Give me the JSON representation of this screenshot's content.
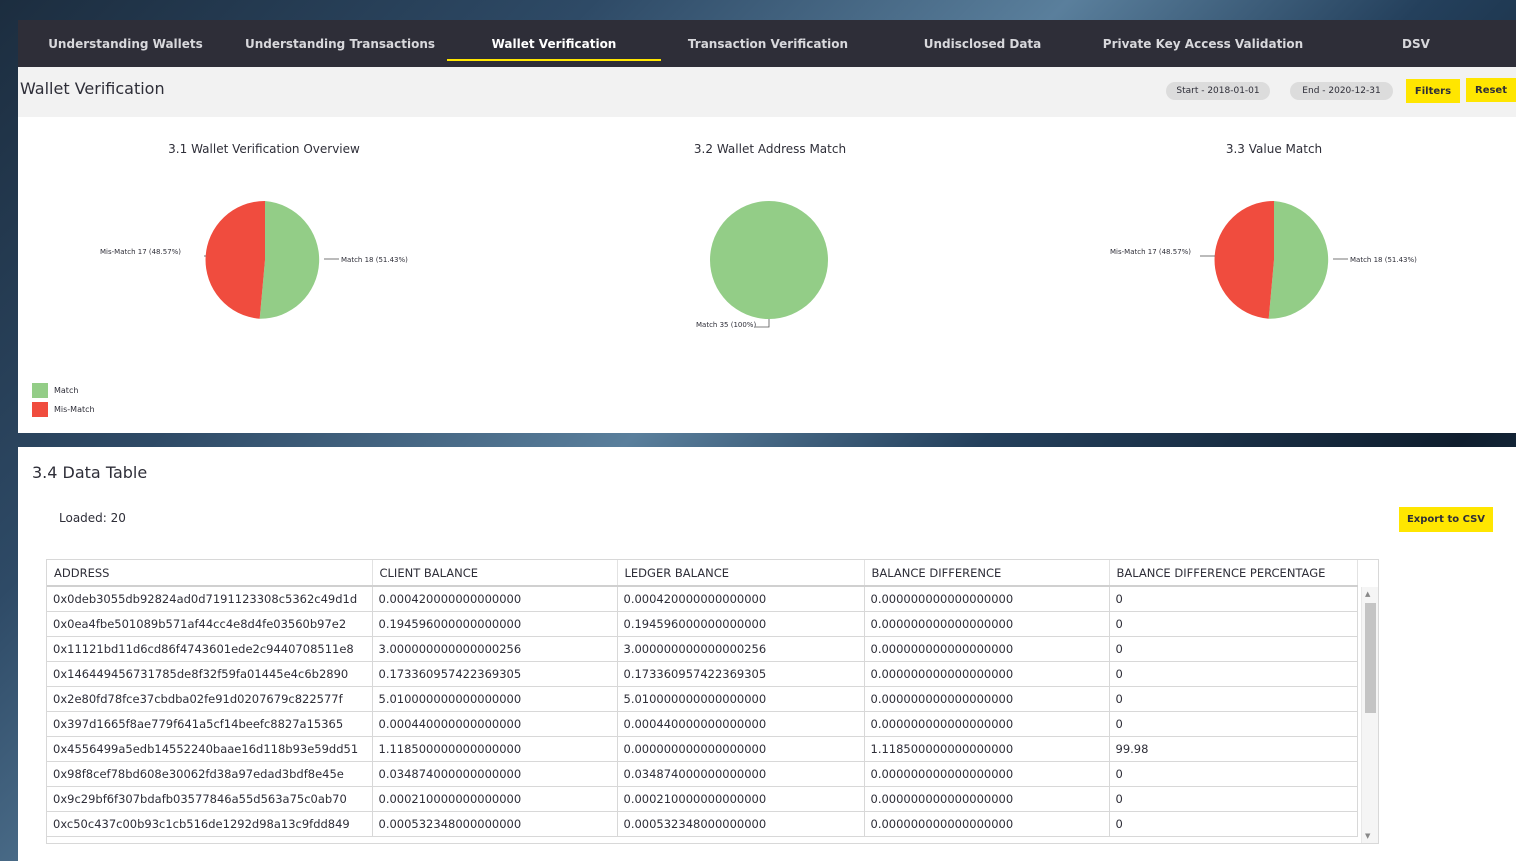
{
  "nav": {
    "tabs": [
      {
        "label": "Understanding Wallets",
        "active": false
      },
      {
        "label": "Understanding Transactions",
        "active": false
      },
      {
        "label": "Wallet Verification",
        "active": true
      },
      {
        "label": "Transaction Verification",
        "active": false
      },
      {
        "label": "Undisclosed Data",
        "active": false
      },
      {
        "label": "Private Key Access Validation",
        "active": false
      },
      {
        "label": "DSV",
        "active": false
      }
    ]
  },
  "header": {
    "title": "Wallet Verification",
    "start": "Start - 2018-01-01",
    "end": "End - 2020-12-31",
    "filters_label": "Filters",
    "reset_label": "Reset"
  },
  "colors": {
    "match": "#93cd87",
    "mismatch": "#f04c3e",
    "accent": "#ffe600",
    "nav_bg": "#2e2e38"
  },
  "charts": {
    "overview": {
      "title": "3.1 Wallet Verification Overview",
      "mismatch_label": "Mis-Match 17 (48.57%)",
      "match_label": "Match 18 (51.43%)"
    },
    "address": {
      "title": "3.2 Wallet Address Match",
      "match_label": "Match 35 (100%)"
    },
    "value": {
      "title": "3.3 Value Match",
      "mismatch_label": "Mis-Match 17 (48.57%)",
      "match_label": "Match 18 (51.43%)"
    },
    "legend": {
      "match": "Match",
      "mismatch": "Mis-Match"
    }
  },
  "chart_data": [
    {
      "type": "pie",
      "title": "3.1 Wallet Verification Overview",
      "categories": [
        "Match",
        "Mis-Match"
      ],
      "values": [
        18,
        17
      ],
      "percent": [
        51.43,
        48.57
      ]
    },
    {
      "type": "pie",
      "title": "3.2 Wallet Address Match",
      "categories": [
        "Match"
      ],
      "values": [
        35
      ],
      "percent": [
        100
      ]
    },
    {
      "type": "pie",
      "title": "3.3 Value Match",
      "categories": [
        "Match",
        "Mis-Match"
      ],
      "values": [
        18,
        17
      ],
      "percent": [
        51.43,
        48.57
      ]
    }
  ],
  "table": {
    "title": "3.4 Data Table",
    "loaded": "Loaded: 20",
    "export_label": "Export to CSV",
    "columns": [
      "ADDRESS",
      "CLIENT BALANCE",
      "LEDGER BALANCE",
      "BALANCE DIFFERENCE",
      "BALANCE DIFFERENCE PERCENTAGE"
    ],
    "rows": [
      [
        "0x0deb3055db92824ad0d7191123308c5362c49d1d",
        "0.000420000000000000",
        "0.000420000000000000",
        "0.000000000000000000",
        "0"
      ],
      [
        "0x0ea4fbe501089b571af44cc4e8d4fe03560b97e2",
        "0.194596000000000000",
        "0.194596000000000000",
        "0.000000000000000000",
        "0"
      ],
      [
        "0x11121bd11d6cd86f4743601ede2c9440708511e8",
        "3.000000000000000256",
        "3.000000000000000256",
        "0.000000000000000000",
        "0"
      ],
      [
        "0x146449456731785de8f32f59fa01445e4c6b2890",
        "0.173360957422369305",
        "0.173360957422369305",
        "0.000000000000000000",
        "0"
      ],
      [
        "0x2e80fd78fce37cbdba02fe91d0207679c822577f",
        "5.010000000000000000",
        "5.010000000000000000",
        "0.000000000000000000",
        "0"
      ],
      [
        "0x397d1665f8ae779f641a5cf14beefc8827a15365",
        "0.000440000000000000",
        "0.000440000000000000",
        "0.000000000000000000",
        "0"
      ],
      [
        "0x4556499a5edb14552240baae16d118b93e59dd51",
        "1.118500000000000000",
        "0.000000000000000000",
        "1.118500000000000000",
        "99.98"
      ],
      [
        "0x98f8cef78bd608e30062fd38a97edad3bdf8e45e",
        "0.034874000000000000",
        "0.034874000000000000",
        "0.000000000000000000",
        "0"
      ],
      [
        "0x9c29bf6f307bdafb03577846a55d563a75c0ab70",
        "0.000210000000000000",
        "0.000210000000000000",
        "0.000000000000000000",
        "0"
      ],
      [
        "0xc50c437c00b93c1cb516de1292d98a13c9fdd849",
        "0.000532348000000000",
        "0.000532348000000000",
        "0.000000000000000000",
        "0"
      ]
    ]
  }
}
